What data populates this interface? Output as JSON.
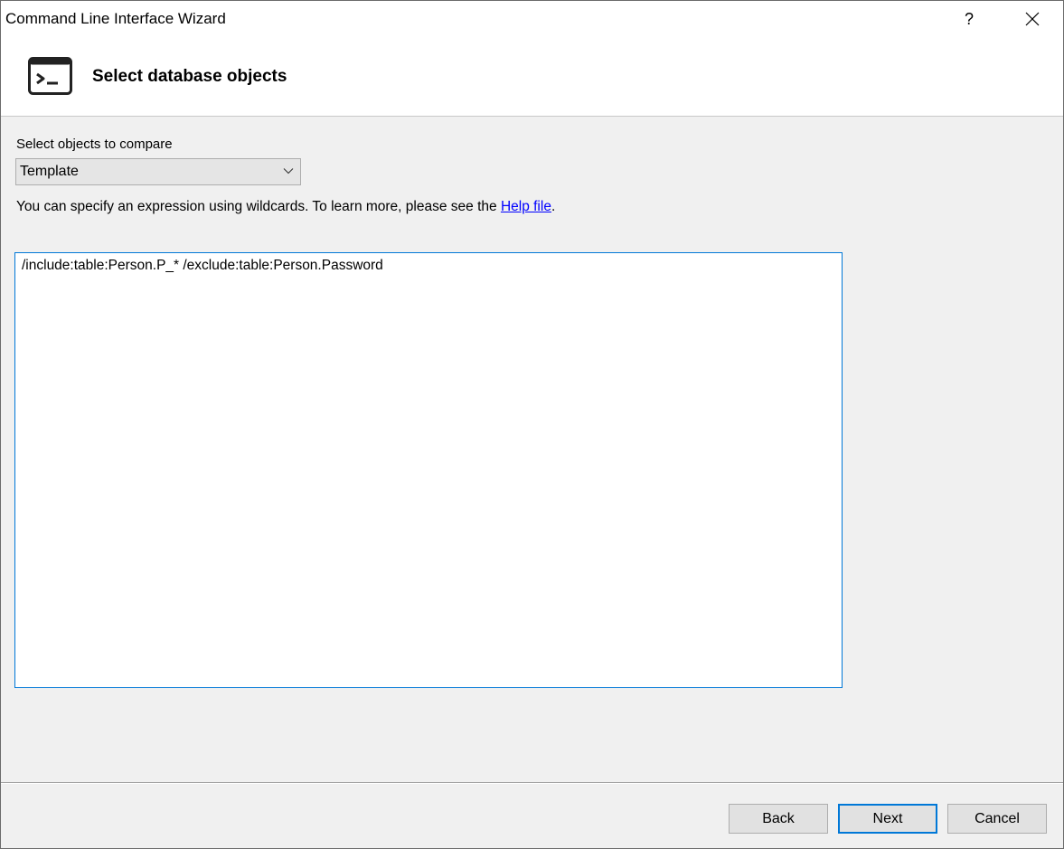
{
  "window": {
    "title": "Command Line Interface Wizard",
    "help_label": "?",
    "close_label": "✕"
  },
  "header": {
    "title": "Select database objects",
    "icon": "terminal-icon"
  },
  "content": {
    "compare_label": "Select objects to compare",
    "compare_select": {
      "value": "Template",
      "icon": "chevron-down-icon"
    },
    "hint": {
      "text_before": "You can specify an expression using wildcards. To learn more, please see the ",
      "link_text": "Help file",
      "text_after": "."
    },
    "expression": "/include:table:Person.P_* /exclude:table:Person.Password"
  },
  "footer": {
    "back_label": "Back",
    "next_label": "Next",
    "cancel_label": "Cancel"
  },
  "colors": {
    "accent": "#0078d7",
    "link": "#0000ff",
    "background": "#f0f0f0"
  }
}
